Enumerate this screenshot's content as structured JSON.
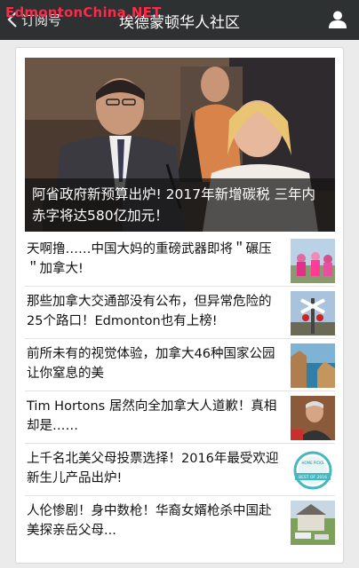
{
  "header": {
    "watermark": "EdmontonChina.NET",
    "back_label": "订阅号",
    "title": "埃德蒙顿华人社区"
  },
  "hero": {
    "caption": "阿省政府新预算出炉! 2017年新增碳税 三年内赤字将达580亿加元！"
  },
  "articles": [
    {
      "title": "天啊撸……中国大妈的重磅武器即将＂碾压＂加拿大!",
      "thumb_icon": "dancing-crowd-thumbnail"
    },
    {
      "title": "那些加拿大交通部没有公布，但异常危险的25个路口！Edmonton也有上榜!",
      "thumb_icon": "railway-crossing-thumbnail"
    },
    {
      "title": "前所未有的视觉体验，加拿大46种国家公园让你窒息的美",
      "thumb_icon": "coastline-thumbnail"
    },
    {
      "title": "Tim Hortons 居然向全加拿大人道歉！真相却是……",
      "thumb_icon": "man-portrait-thumbnail"
    },
    {
      "title": "上千名北美父母投票选择！2016年最受欢迎新生儿产品出炉!",
      "thumb_icon": "award-badge-thumbnail",
      "badge_top": "HOME PICKS",
      "badge_bottom": "BEST OF 2016"
    },
    {
      "title": "人伦惨剧！身中数枪！华裔女婿枪杀中国赴美探亲岳父母...",
      "thumb_icon": "house-street-thumbnail"
    }
  ]
}
